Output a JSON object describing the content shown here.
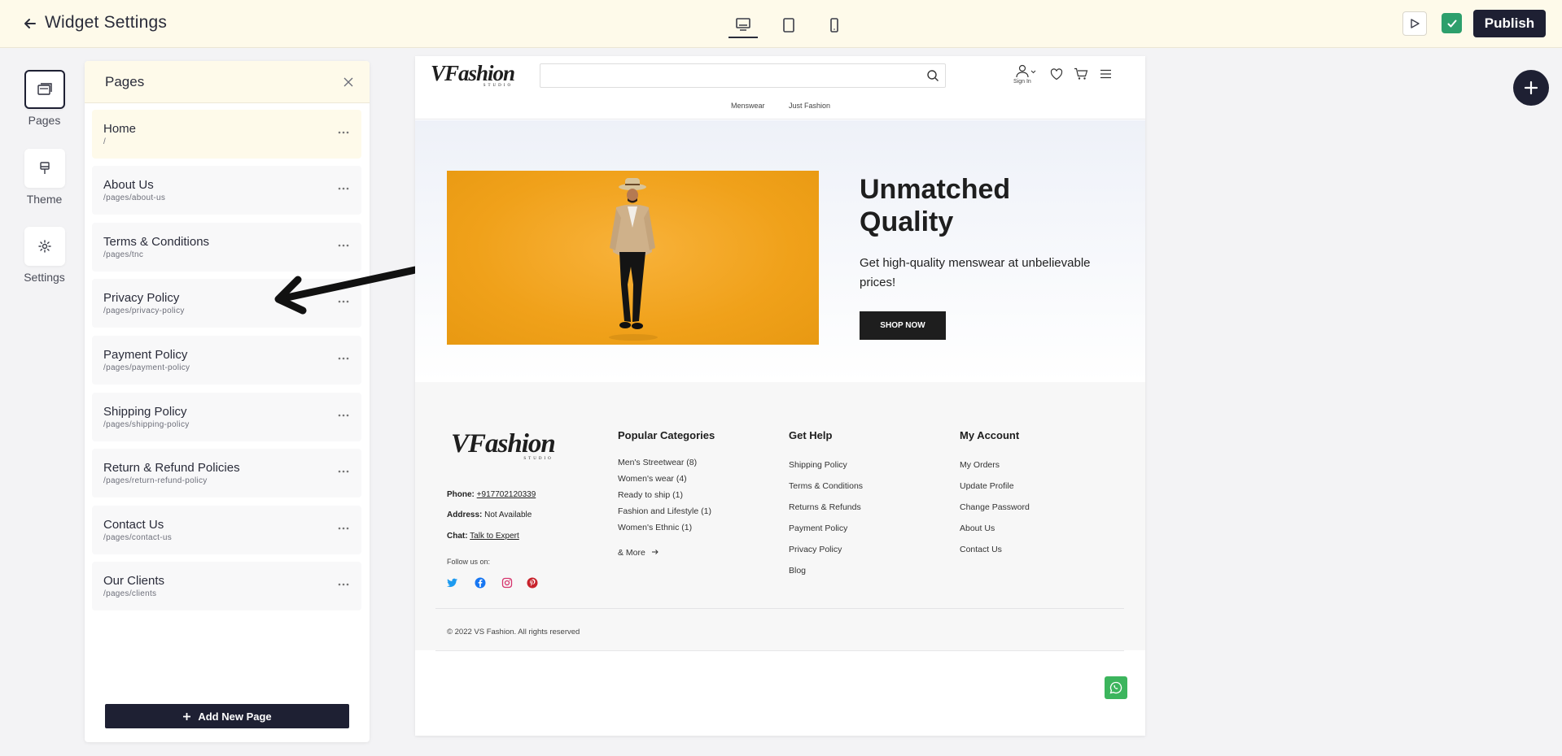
{
  "topbar": {
    "title": "Widget Settings",
    "publish_label": "Publish",
    "devices": [
      "desktop-icon",
      "tablet-icon",
      "mobile-icon"
    ]
  },
  "rail": {
    "pages_label": "Pages",
    "theme_label": "Theme",
    "settings_label": "Settings"
  },
  "panel": {
    "title": "Pages",
    "add_label": "Add New Page",
    "items": [
      {
        "name": "Home",
        "path": "/"
      },
      {
        "name": "About Us",
        "path": "/pages/about-us"
      },
      {
        "name": "Terms & Conditions",
        "path": "/pages/tnc"
      },
      {
        "name": "Privacy Policy",
        "path": "/pages/privacy-policy"
      },
      {
        "name": "Payment Policy",
        "path": "/pages/payment-policy"
      },
      {
        "name": "Shipping Policy",
        "path": "/pages/shipping-policy"
      },
      {
        "name": "Return & Refund Policies",
        "path": "/pages/return-refund-policy"
      },
      {
        "name": "Contact Us",
        "path": "/pages/contact-us"
      },
      {
        "name": "Our Clients",
        "path": "/pages/clients"
      }
    ]
  },
  "site": {
    "logo_main": "VFashion",
    "logo_sub": "STUDIO",
    "signin_label": "Sign In",
    "nav": [
      "Menswear",
      "Just Fashion"
    ],
    "hero": {
      "title": "Unmatched Quality",
      "subtitle": "Get high-quality menswear at unbelievable prices!",
      "cta": "SHOP NOW"
    },
    "footer": {
      "phone_label": "Phone:",
      "phone": "+917702120339",
      "address_label": "Address:",
      "address": "Not Available",
      "chat_label": "Chat:",
      "chat": "Talk to Expert",
      "follow": "Follow us on:",
      "col1_title": "Popular Categories",
      "col1": [
        "Men's Streetwear (8)",
        "Women's wear (4)",
        "Ready to ship (1)",
        "Fashion and Lifestyle (1)",
        "Women's Ethnic (1)"
      ],
      "more": "& More",
      "col2_title": "Get Help",
      "col2": [
        "Shipping Policy",
        "Terms & Conditions",
        "Returns & Refunds",
        "Payment Policy",
        "Privacy Policy",
        "Blog"
      ],
      "col3_title": "My Account",
      "col3": [
        "My Orders",
        "Update Profile",
        "Change Password",
        "About Us",
        "Contact Us"
      ],
      "copyright": "© 2022 VS Fashion. All rights reserved"
    }
  },
  "colors": {
    "topbar_bg": "#fefaea",
    "primary_dark": "#1e2033",
    "success": "#2d9f6c",
    "hero_orange": "#f0a11a",
    "whatsapp": "#3cb55d"
  }
}
